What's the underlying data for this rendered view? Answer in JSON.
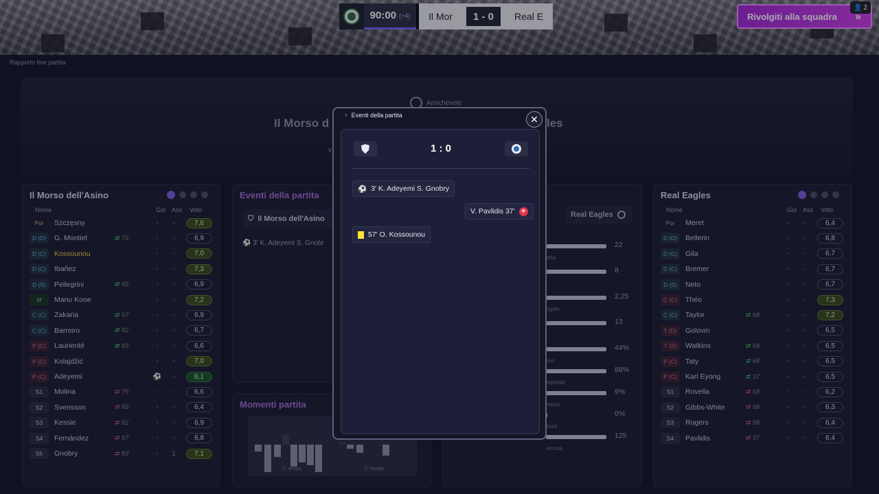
{
  "header": {
    "time": "90:00",
    "added_time": "(+4)",
    "home_short": "Il Mor",
    "score": "1 - 0",
    "away_short": "Real E",
    "talk_button": "Rivolgiti alla squadra",
    "notifications": "2"
  },
  "breadcrumb": "Rapporto fine partita",
  "match_header": {
    "competition": "Amichevole",
    "title_left": "Il Morso d",
    "title_right": "les",
    "vs": "v"
  },
  "home_team": {
    "name": "Il Morso dell'Asino",
    "col_name": "Nome",
    "col_gol": "Gol",
    "col_ass": "Ass",
    "col_voto": "Voto",
    "players": [
      {
        "pos": "Por",
        "type": "gk",
        "name": "Szczęsny",
        "sub": "",
        "subdir": "",
        "gol": "-",
        "ass": "-",
        "vote": "7,6",
        "vstyle": "g"
      },
      {
        "pos": "D (D)",
        "type": "d",
        "name": "G. Montiel",
        "sub": "75'",
        "subdir": "out",
        "gol": "-",
        "ass": "-",
        "vote": "6,9",
        "vstyle": ""
      },
      {
        "pos": "D (C)",
        "type": "d",
        "name": "Kossounou",
        "sub": "",
        "subdir": "",
        "gol": "-",
        "ass": "-",
        "vote": "7,0",
        "vstyle": "g",
        "yellow": true
      },
      {
        "pos": "D (C)",
        "type": "d",
        "name": "Ibañez",
        "sub": "",
        "subdir": "",
        "gol": "-",
        "ass": "-",
        "vote": "7,3",
        "vstyle": "g"
      },
      {
        "pos": "D (S)",
        "type": "d",
        "name": "Pellegrini",
        "sub": "65'",
        "subdir": "out",
        "gol": "-",
        "ass": "-",
        "vote": "6,9",
        "vstyle": ""
      },
      {
        "pos": "M",
        "type": "m",
        "name": "Manu Kone",
        "sub": "",
        "subdir": "",
        "gol": "-",
        "ass": "-",
        "vote": "7,2",
        "vstyle": "g"
      },
      {
        "pos": "C (C)",
        "type": "d",
        "name": "Zakaria",
        "sub": "67'",
        "subdir": "out",
        "gol": "-",
        "ass": "-",
        "vote": "6,9",
        "vstyle": ""
      },
      {
        "pos": "C (C)",
        "type": "d",
        "name": "Barreiro",
        "sub": "81'",
        "subdir": "out",
        "gol": "-",
        "ass": "-",
        "vote": "6,7",
        "vstyle": ""
      },
      {
        "pos": "P (C)",
        "type": "a",
        "name": "Laurienté",
        "sub": "83'",
        "subdir": "out",
        "gol": "-",
        "ass": "-",
        "vote": "6,6",
        "vstyle": ""
      },
      {
        "pos": "P (C)",
        "type": "a",
        "name": "Kolajdžić",
        "sub": "",
        "subdir": "",
        "gol": "-",
        "ass": "-",
        "vote": "7,0",
        "vstyle": "g"
      },
      {
        "pos": "P (C)",
        "type": "a",
        "name": "Adeyemi",
        "sub": "",
        "subdir": "",
        "gol": "⚽",
        "ass": "-",
        "vote": "8,1",
        "vstyle": "gg"
      },
      {
        "pos": "S1",
        "type": "s",
        "name": "Molina",
        "sub": "75'",
        "subdir": "in",
        "gol": "-",
        "ass": "-",
        "vote": "6,6",
        "vstyle": ""
      },
      {
        "pos": "S2",
        "type": "s",
        "name": "Svensson",
        "sub": "65'",
        "subdir": "in",
        "gol": "-",
        "ass": "-",
        "vote": "6,4",
        "vstyle": ""
      },
      {
        "pos": "S3",
        "type": "s",
        "name": "Kessie",
        "sub": "81'",
        "subdir": "in",
        "gol": "-",
        "ass": "-",
        "vote": "6,9",
        "vstyle": ""
      },
      {
        "pos": "S4",
        "type": "s",
        "name": "Fernández",
        "sub": "67'",
        "subdir": "in",
        "gol": "-",
        "ass": "-",
        "vote": "6,8",
        "vstyle": ""
      },
      {
        "pos": "S5",
        "type": "s",
        "name": "Gnobry",
        "sub": "83'",
        "subdir": "in",
        "gol": "-",
        "ass": "1",
        "vote": "7,1",
        "vstyle": "g"
      }
    ]
  },
  "away_team": {
    "name": "Real Eagles",
    "col_name": "Nome",
    "col_gol": "Gol",
    "col_ass": "Ass",
    "col_voto": "Voto",
    "players": [
      {
        "pos": "Por",
        "type": "gk",
        "name": "Meret",
        "sub": "",
        "subdir": "",
        "gol": "-",
        "ass": "-",
        "vote": "6,4",
        "vstyle": ""
      },
      {
        "pos": "D (D)",
        "type": "d",
        "name": "Bellerin",
        "sub": "",
        "subdir": "",
        "gol": "-",
        "ass": "-",
        "vote": "6,8",
        "vstyle": ""
      },
      {
        "pos": "D (C)",
        "type": "d",
        "name": "Gila",
        "sub": "",
        "subdir": "",
        "gol": "-",
        "ass": "-",
        "vote": "6,7",
        "vstyle": ""
      },
      {
        "pos": "D (C)",
        "type": "d",
        "name": "Bremer",
        "sub": "",
        "subdir": "",
        "gol": "-",
        "ass": "-",
        "vote": "6,7",
        "vstyle": ""
      },
      {
        "pos": "D (S)",
        "type": "d",
        "name": "Neto",
        "sub": "",
        "subdir": "",
        "gol": "-",
        "ass": "-",
        "vote": "6,7",
        "vstyle": ""
      },
      {
        "pos": "C (C)",
        "type": "a",
        "name": "Théo",
        "sub": "",
        "subdir": "",
        "gol": "-",
        "ass": "-",
        "vote": "7,3",
        "vstyle": "g"
      },
      {
        "pos": "C (C)",
        "type": "d",
        "name": "Taylor",
        "sub": "68'",
        "subdir": "out",
        "gol": "-",
        "ass": "-",
        "vote": "7,2",
        "vstyle": "g"
      },
      {
        "pos": "T (D)",
        "type": "a",
        "name": "Golovin",
        "sub": "",
        "subdir": "",
        "gol": "-",
        "ass": "-",
        "vote": "6,5",
        "vstyle": ""
      },
      {
        "pos": "T (S)",
        "type": "a",
        "name": "Watkins",
        "sub": "68'",
        "subdir": "out",
        "gol": "-",
        "ass": "-",
        "vote": "6,5",
        "vstyle": ""
      },
      {
        "pos": "P (C)",
        "type": "a",
        "name": "Taty",
        "sub": "68'",
        "subdir": "out",
        "gol": "-",
        "ass": "-",
        "vote": "6,5",
        "vstyle": ""
      },
      {
        "pos": "P (C)",
        "type": "a",
        "name": "Karl Eyong",
        "sub": "37'",
        "subdir": "out",
        "gol": "-",
        "ass": "-",
        "vote": "6,5",
        "vstyle": ""
      },
      {
        "pos": "S1",
        "type": "s",
        "name": "Rovella",
        "sub": "68'",
        "subdir": "in",
        "gol": "-",
        "ass": "-",
        "vote": "6,2",
        "vstyle": ""
      },
      {
        "pos": "S2",
        "type": "s",
        "name": "Gibbs-White",
        "sub": "68'",
        "subdir": "in",
        "gol": "-",
        "ass": "-",
        "vote": "6,3",
        "vstyle": ""
      },
      {
        "pos": "S3",
        "type": "s",
        "name": "Rogers",
        "sub": "68'",
        "subdir": "in",
        "gol": "-",
        "ass": "-",
        "vote": "6,4",
        "vstyle": ""
      },
      {
        "pos": "S4",
        "type": "s",
        "name": "Pavlidis",
        "sub": "37'",
        "subdir": "in",
        "gol": "-",
        "ass": "-",
        "vote": "6,4",
        "vstyle": ""
      }
    ]
  },
  "events_card": {
    "title": "Eventi della partita",
    "team": "Il Morso dell'Asino",
    "event": "3' K. Adeyemi S. Gnobr"
  },
  "moments_card": {
    "title": "Momenti partita",
    "half1": "1° tempo",
    "half2": "2° tempo"
  },
  "stats_card": {
    "team": "Real Eagles",
    "values": [
      "22",
      "8",
      "2,25",
      "13",
      "44%",
      "88%",
      "9%",
      "0%",
      "125"
    ],
    "labels": [
      "orta",
      "",
      "ngolo",
      "",
      "sso",
      "mpletati",
      "messi",
      "zioni",
      "arcosa"
    ]
  },
  "modal": {
    "title": "Eventi della partita",
    "score": "1 : 0",
    "events": [
      {
        "type": "goal",
        "side": "home",
        "text": "3'  K. Adeyemi  S. Gnobry"
      },
      {
        "type": "red",
        "side": "away",
        "text": "V. Pavlidis  37'"
      },
      {
        "type": "yellow",
        "side": "home",
        "text": "57'  O. Kossounou"
      }
    ]
  }
}
